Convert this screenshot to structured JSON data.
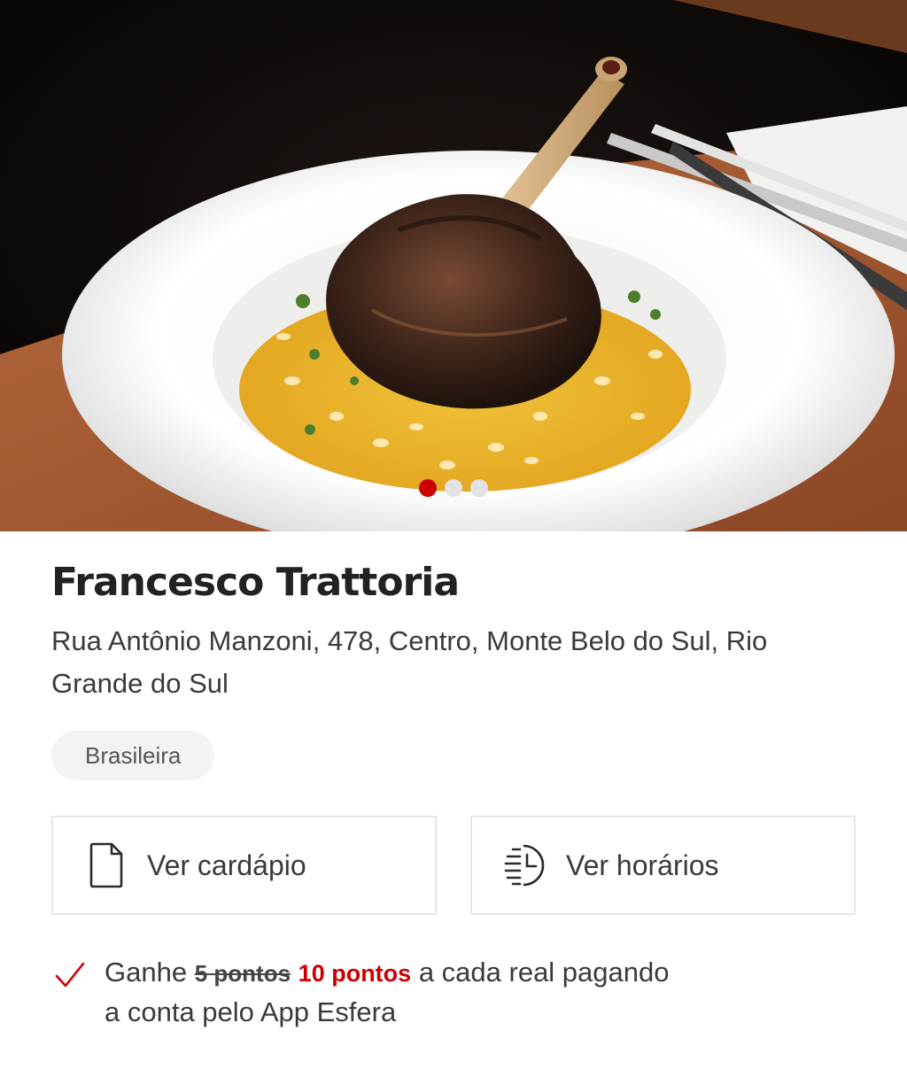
{
  "hero": {
    "image_alt": "Prato de pernil de cordeiro sobre risoto de açafrão",
    "slides": [
      {
        "active": true
      },
      {
        "active": false
      },
      {
        "active": false
      }
    ]
  },
  "restaurant": {
    "name": "Francesco Trattoria",
    "address": "Rua Antônio Manzoni, 478, Centro, Monte Belo do Sul, Rio Grande do Sul",
    "cuisine": "Brasileira"
  },
  "actions": {
    "menu_label": "Ver cardápio",
    "menu_icon": "document-icon",
    "hours_label": "Ver horários",
    "hours_icon": "clock-schedule-icon"
  },
  "reward": {
    "icon": "check-icon",
    "prefix": "Ganhe",
    "old_points": "5 pontos",
    "new_points": "10 pontos",
    "suffix": "a cada real pagando a conta pelo App Esfera"
  },
  "colors": {
    "accent": "#cc0000",
    "text": "#3a3a3a",
    "title": "#222222",
    "tag_bg": "#f3f3f3",
    "border": "#e6e6e6"
  }
}
